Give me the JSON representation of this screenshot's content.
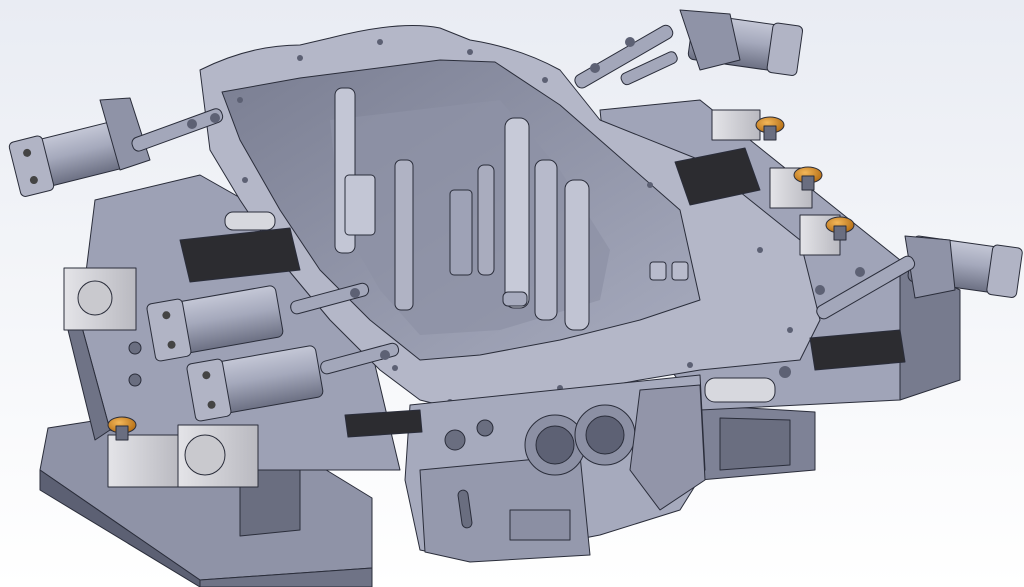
{
  "scene": {
    "subject": "cad-assembly",
    "colors": {
      "background_top": "#e9ecf3",
      "background_bottom": "#ffffff",
      "metal_light": "#b9bccd",
      "metal_mid": "#9ea2b6",
      "metal_dark": "#6f7386",
      "metal_shadow": "#4d5061",
      "edge": "#2a2d3a",
      "pad_black": "#2c2c30",
      "knob_orange": "#d98a1f",
      "steel_block": "#d8d8dc"
    },
    "counts": {
      "pneumatic_cylinders": 5,
      "toggle_clamps": 6,
      "black_pads": 4,
      "locating_pins": 4
    }
  }
}
